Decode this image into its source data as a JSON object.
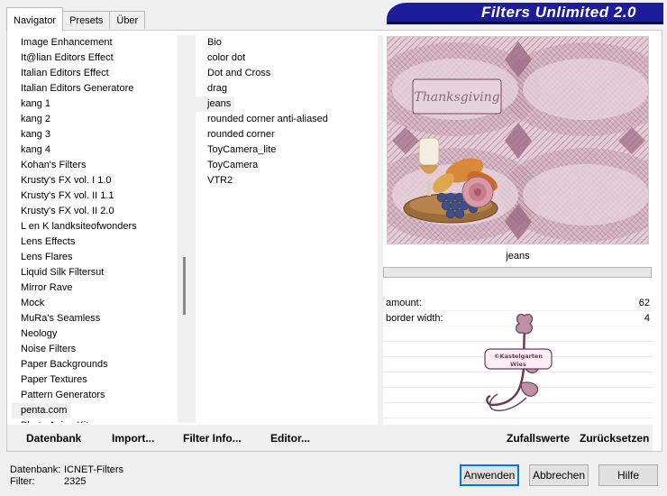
{
  "tabs": [
    "Navigator",
    "Presets",
    "Über"
  ],
  "app_title": "Filters Unlimited 2.0",
  "categories": [
    "Image Enhancement",
    "It@lian Editors Effect",
    "Italian Editors Effect",
    "Italian Editors Generatore",
    "kang 1",
    "kang 2",
    "kang 3",
    "kang 4",
    "Kohan's Filters",
    "Krusty's FX vol. I 1.0",
    "Krusty's FX vol. II 1.1",
    "Krusty's FX vol. II 2.0",
    "L en K landksiteofwonders",
    "Lens Effects",
    "Lens Flares",
    "Liquid Silk Filtersut",
    "Mirror Rave",
    "Mock",
    "MuRa's Seamless",
    "Neology",
    "Noise Filters",
    "Paper Backgrounds",
    "Paper Textures",
    "Pattern Generators",
    "penta.com",
    "Photo Aging Kit"
  ],
  "selected_category": "penta.com",
  "filters": [
    "Bio",
    "color dot",
    "Dot and Cross",
    "drag",
    "jeans",
    "rounded corner anti-aliased",
    "rounded corner",
    "ToyCamera_lite",
    "ToyCamera",
    "VTR2"
  ],
  "selected_filter": "jeans",
  "preview": {
    "thanksgiving_text": "Thanksgiving"
  },
  "filter_name": "jeans",
  "params": [
    {
      "label": "amount:",
      "value": "62"
    },
    {
      "label": "border width:",
      "value": "4"
    }
  ],
  "watermark_text": [
    "©Kastelgarten",
    "Wies"
  ],
  "buttons": {
    "datenbank": "Datenbank",
    "import": "Import...",
    "filter_info": "Filter Info...",
    "editor": "Editor...",
    "random": "Zufallswerte",
    "reset": "Zurücksetzen",
    "apply": "Anwenden",
    "cancel": "Abbrechen",
    "help": "Hilfe"
  },
  "status": {
    "db_label": "Datenbank:",
    "db_value": "ICNET-Filters",
    "filter_label": "Filter:",
    "filter_value": "2325"
  },
  "colors": {
    "banner": "#1d1d9a",
    "accent": "#0078d7",
    "preview_bg": "#e9d6de"
  }
}
